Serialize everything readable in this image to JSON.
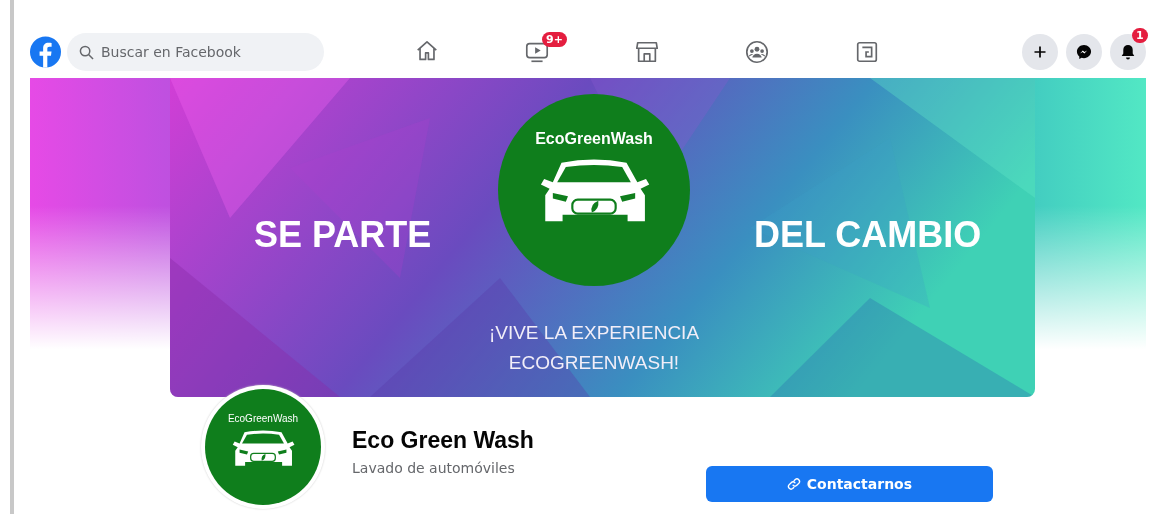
{
  "top_bar": {
    "search": {
      "placeholder": "Buscar en Facebook"
    },
    "nav": [
      {
        "kind": "home"
      },
      {
        "kind": "video",
        "badge": "9+"
      },
      {
        "kind": "store"
      },
      {
        "kind": "groups"
      },
      {
        "kind": "gaming"
      }
    ],
    "actions": [
      {
        "kind": "plus"
      },
      {
        "kind": "messenger"
      },
      {
        "kind": "bell",
        "badge": "1"
      }
    ]
  },
  "cover": {
    "left_text": "SE PARTE",
    "right_text": "DEL CAMBIO",
    "logo_text": "EcoGreenWash",
    "tagline": [
      "¡VIVE LA EXPERIENCIA",
      "ECOGREENWASH!"
    ]
  },
  "profile": {
    "logo_text": "EcoGreenWash",
    "name": "Eco Green Wash",
    "category": "Lavado de automóviles",
    "button": "Contactarnos"
  }
}
